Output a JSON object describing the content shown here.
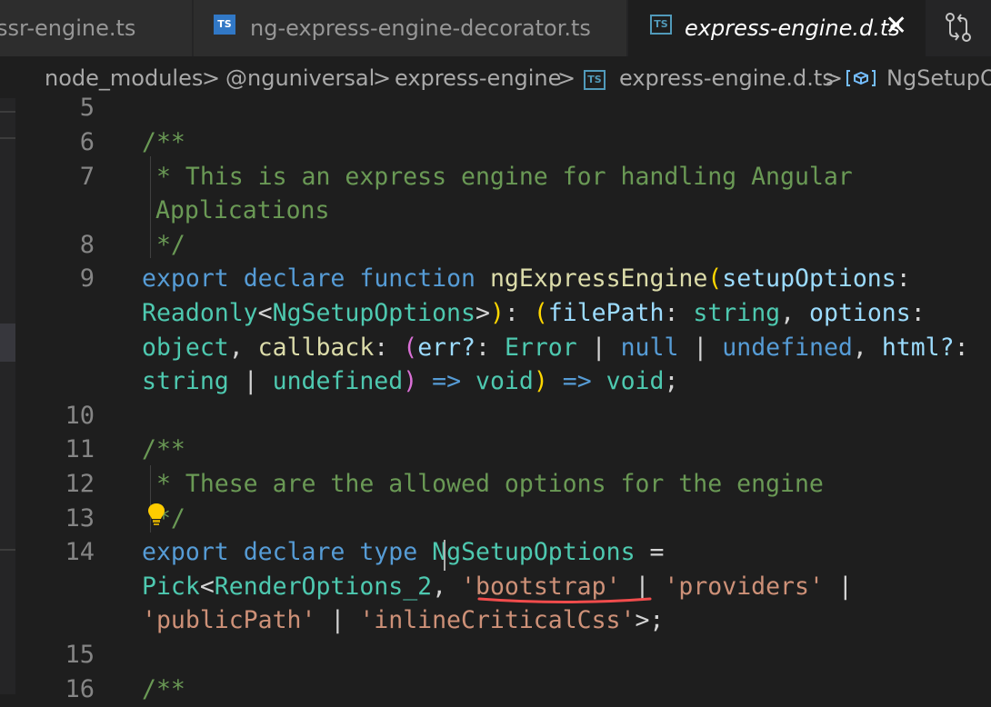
{
  "tabs": [
    {
      "label": "ssr-engine.ts"
    },
    {
      "label": "ng-express-engine-decorator.ts",
      "icon": "typescript-file-icon"
    },
    {
      "label": "express-engine.d.ts",
      "icon": "typescript-file-icon",
      "active": true
    }
  ],
  "tab_icon_text": "TS",
  "breadcrumb": {
    "items": [
      "node_modules",
      "@nguniversal",
      "express-engine",
      "express-engine.d.ts",
      "NgSetupOptions"
    ],
    "separator": ">"
  },
  "editor": {
    "line_numbers": [
      "5",
      "6",
      "7",
      "",
      "8",
      "9",
      "",
      "",
      "",
      "10",
      "11",
      "12",
      "13",
      "14",
      "",
      "",
      "15",
      "16"
    ],
    "lines": {
      "l6": "/**",
      "l7a": " * This is an express engine for handling Angular",
      "l7b": "Applications",
      "l8": " */",
      "l9a": {
        "t1": "export",
        "t2": "declare",
        "t3": "function",
        "t4": "ngExpressEngine",
        "t5": "(",
        "t6": "setupOptions",
        "t7": ":"
      },
      "l9b": {
        "t1": "Readonly",
        "t2": "<",
        "t3": "NgSetupOptions",
        "t4": ">",
        "t5": ")",
        "t6": ": ",
        "t7": "(",
        "t8": "filePath",
        "t9": ": ",
        "t10": "string",
        "t11": ", ",
        "t12": "options",
        "t13": ":"
      },
      "l9c": {
        "t1": "object",
        "t2": ", ",
        "t3": "callback",
        "t4": ": ",
        "t5": "(",
        "t6": "err?",
        "t7": ": ",
        "t8": "Error",
        "t9": " | ",
        "t10": "null",
        "t11": " | ",
        "t12": "undefined",
        "t13": ", ",
        "t14": "html?",
        "t15": ":"
      },
      "l9d": {
        "t1": "string",
        "t2": " | ",
        "t3": "undefined",
        "t4": ")",
        "t5": " => ",
        "t6": "void",
        "t7": ")",
        "t8": " => ",
        "t9": "void",
        "t10": ";"
      },
      "l11": "/**",
      "l12": " * These are the allowed options for the engine",
      "l13": " */",
      "l14a": {
        "t1": "export",
        "t2": "declare",
        "t3": "type",
        "t4": "NgSetupOptions",
        "t5": " ="
      },
      "l14b": {
        "t1": "Pick",
        "t2": "<",
        "t3": "RenderOptions_2",
        "t4": ", ",
        "t5": "'bootstrap'",
        "t6": " | ",
        "t7": "'providers'",
        "t8": " |"
      },
      "l14c": {
        "t1": "'publicPath'",
        "t2": " | ",
        "t3": "'inlineCriticalCss'",
        "t4": ">;"
      },
      "l16": "/**"
    }
  },
  "colors": {
    "background": "#1e1e1e",
    "comment": "#6a9955",
    "keyword": "#569cd6",
    "function": "#dcdcaa",
    "type": "#4ec9b0",
    "parameter": "#9cdcfe",
    "string": "#ce9178",
    "error_squiggle": "#f14c4c",
    "lightbulb": "#ffcc00"
  }
}
